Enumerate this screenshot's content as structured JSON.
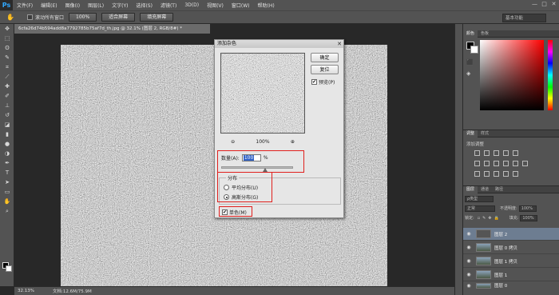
{
  "app": {
    "logo": "Ps"
  },
  "menu": [
    "文件(F)",
    "编辑(E)",
    "图像(I)",
    "图层(L)",
    "文字(Y)",
    "选择(S)",
    "滤镜(T)",
    "3D(D)",
    "视图(V)",
    "窗口(W)",
    "帮助(H)"
  ],
  "window_controls": {
    "minimize": "—",
    "restore": "□",
    "close": "✕"
  },
  "options_bar": {
    "scroll_all_windows": "滚动所有窗口",
    "btn_100": "100%",
    "btn_fit_screen": "适合屏幕",
    "btn_fill_screen": "填充屏幕",
    "workspace": "基本功能"
  },
  "document": {
    "tab_title": "6cfa26d74b594add8a7792785b75af7d_th.jpg @ 32.1% (图层 2, RGB/8#) *"
  },
  "status": {
    "zoom": "32.13%",
    "doc": "文档:12.6M/75.9M"
  },
  "color_panel": {
    "tabs": [
      "颜色",
      "色板"
    ]
  },
  "adjust_panel": {
    "tabs": [
      "调整",
      "样式"
    ],
    "title": "添加调整"
  },
  "layers_panel": {
    "tabs": [
      "图层",
      "通道",
      "路径"
    ],
    "filter_kind": "ρ类型",
    "blend_mode": "正常",
    "opacity_label": "不透明度:",
    "opacity_value": "100%",
    "lock_label": "锁定:",
    "fill_label": "填充:",
    "fill_value": "100%",
    "layers": [
      {
        "name": "图层 2",
        "active": true
      },
      {
        "name": "图层 0 拷贝",
        "active": false
      },
      {
        "name": "图层 1 拷贝",
        "active": false
      },
      {
        "name": "图层 1",
        "active": false
      },
      {
        "name": "图层 0",
        "active": false
      }
    ]
  },
  "dialog": {
    "title": "添加杂色",
    "ok": "确定",
    "reset": "复位",
    "preview_label": "预览(P)",
    "preview_checked": "✔",
    "zoom_level": "100%",
    "amount_label": "数量(A):",
    "amount_value": "100",
    "amount_unit": "%",
    "distribution_label": "分布",
    "uniform": "平均分布(U)",
    "gaussian": "高斯分布(G)",
    "monochrome": "单色(M)",
    "monochrome_checked": "✔"
  }
}
